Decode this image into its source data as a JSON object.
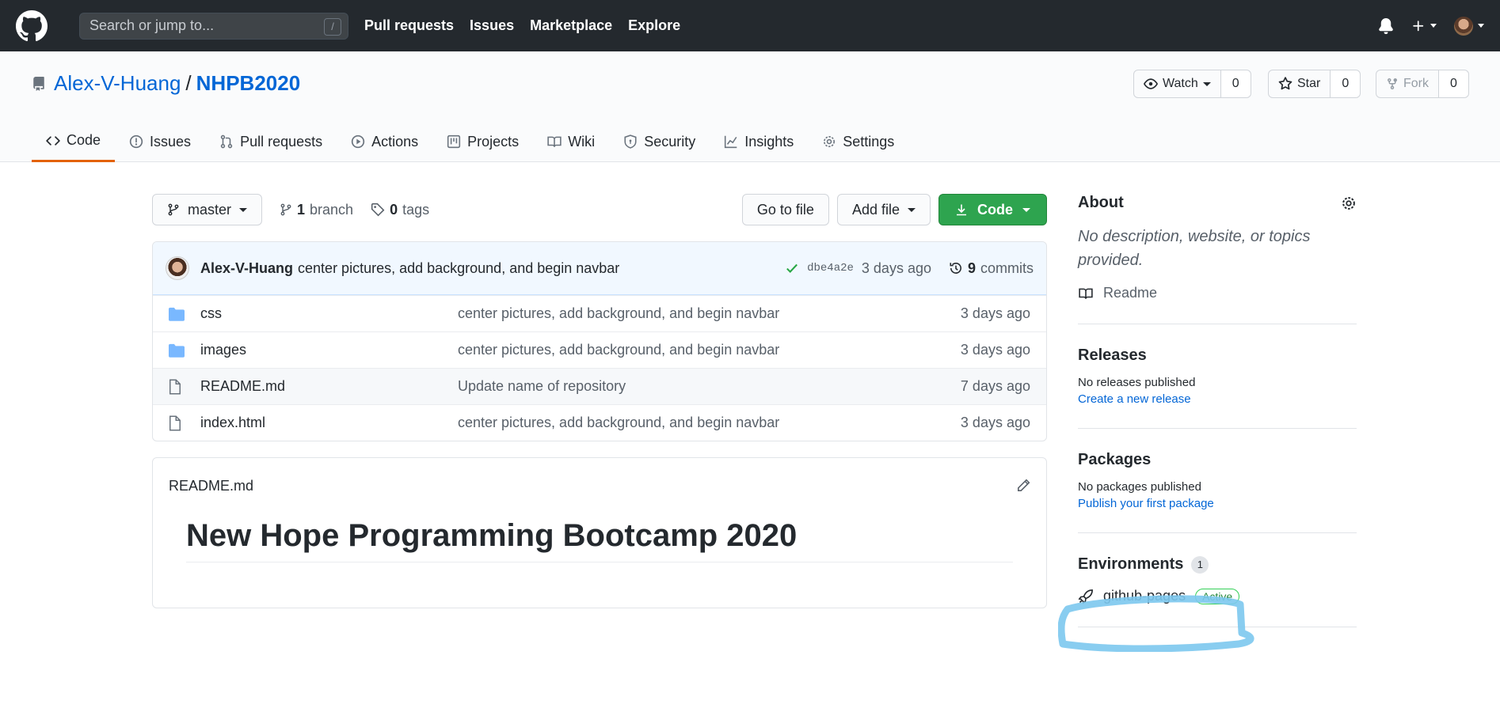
{
  "header": {
    "search_placeholder": "Search or jump to...",
    "search_shortcut": "/",
    "nav": [
      "Pull requests",
      "Issues",
      "Marketplace",
      "Explore"
    ]
  },
  "repo": {
    "owner": "Alex-V-Huang",
    "separator": "/",
    "name": "NHPB2020",
    "watch": {
      "label": "Watch",
      "count": "0"
    },
    "star": {
      "label": "Star",
      "count": "0"
    },
    "fork": {
      "label": "Fork",
      "count": "0"
    }
  },
  "tabs": [
    {
      "label": "Code",
      "icon": "code-icon"
    },
    {
      "label": "Issues",
      "icon": "issue-icon"
    },
    {
      "label": "Pull requests",
      "icon": "pull-request-icon"
    },
    {
      "label": "Actions",
      "icon": "play-icon"
    },
    {
      "label": "Projects",
      "icon": "project-icon"
    },
    {
      "label": "Wiki",
      "icon": "book-icon"
    },
    {
      "label": "Security",
      "icon": "shield-icon"
    },
    {
      "label": "Insights",
      "icon": "graph-icon"
    },
    {
      "label": "Settings",
      "icon": "gear-icon"
    }
  ],
  "toolbar": {
    "branch": "master",
    "branch_count": "1",
    "branch_label": "branch",
    "tag_count": "0",
    "tag_label": "tags",
    "go_to_file": "Go to file",
    "add_file": "Add file",
    "code": "Code"
  },
  "commit": {
    "author": "Alex-V-Huang",
    "message": "center pictures, add background, and begin navbar",
    "sha": "dbe4a2e",
    "time": "3 days ago",
    "count": "9",
    "count_label": "commits"
  },
  "files": [
    {
      "name": "css",
      "type": "folder",
      "message": "center pictures, add background, and begin navbar",
      "age": "3 days ago"
    },
    {
      "name": "images",
      "type": "folder",
      "message": "center pictures, add background, and begin navbar",
      "age": "3 days ago"
    },
    {
      "name": "README.md",
      "type": "file",
      "message": "Update name of repository",
      "age": "7 days ago"
    },
    {
      "name": "index.html",
      "type": "file",
      "message": "center pictures, add background, and begin navbar",
      "age": "3 days ago"
    }
  ],
  "readme": {
    "filename": "README.md",
    "heading": "New Hope Programming Bootcamp 2020"
  },
  "sidebar": {
    "about_title": "About",
    "about_desc": "No description, website, or topics provided.",
    "readme_link": "Readme",
    "releases_title": "Releases",
    "releases_none": "No releases published",
    "releases_link": "Create a new release",
    "packages_title": "Packages",
    "packages_none": "No packages published",
    "packages_link": "Publish your first package",
    "env_title": "Environments",
    "env_count": "1",
    "env_name": "github-pages",
    "env_status": "Active"
  },
  "colors": {
    "accent_blue": "#0366d6",
    "green": "#2ea44f",
    "highlight_marker": "#7cc8ee",
    "tab_underline": "#e36209"
  }
}
